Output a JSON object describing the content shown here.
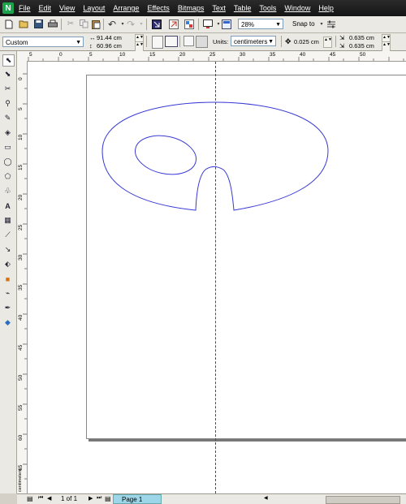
{
  "app": {
    "logo_glyph": "N"
  },
  "menu": [
    "File",
    "Edit",
    "View",
    "Layout",
    "Arrange",
    "Effects",
    "Bitmaps",
    "Text",
    "Table",
    "Tools",
    "Window",
    "Help"
  ],
  "toolbar": {
    "zoom_value": "28%",
    "snap_to_label": "Snap to",
    "icons": [
      "new-document-icon",
      "open-icon",
      "save-icon",
      "print-icon",
      "cut-icon",
      "copy-icon",
      "paste-icon",
      "undo-icon",
      "redo-icon",
      "import-icon",
      "export-icon",
      "launcher-icon",
      "full-screen-icon",
      "welcome-icon",
      "options-icon"
    ]
  },
  "property_bar": {
    "paper_type": "Custom",
    "width": "91.44 cm",
    "height": "60.96 cm",
    "units_label": "Units:",
    "units_value": "centimeters",
    "nudge_value": "0.025 cm",
    "dup_x": "0.635 cm",
    "dup_y": "0.635 cm"
  },
  "rulers": {
    "top_ticks": [
      "5",
      "0",
      "5",
      "10",
      "15",
      "20",
      "25",
      "30",
      "35",
      "40",
      "45",
      "50"
    ],
    "left_ticks": [
      "0",
      "5",
      "10",
      "15",
      "20",
      "25",
      "30",
      "35",
      "40",
      "45",
      "50",
      "55",
      "60",
      "65"
    ],
    "left_unit": "centimeters"
  },
  "page_nav": {
    "page_count": "1 of 1",
    "page_tab": "Page 1"
  },
  "colors": {
    "outline": "#3a3ad6",
    "menubar": "#1c1c1c",
    "page_tab": "#9dd6e8"
  }
}
